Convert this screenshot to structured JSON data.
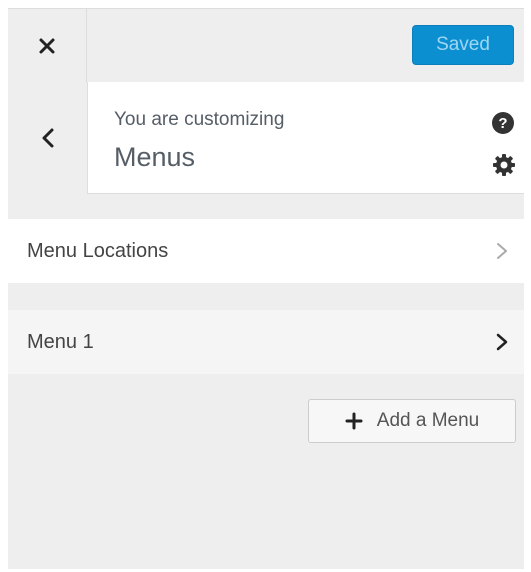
{
  "header": {
    "close_icon": "close-icon",
    "saved_label": "Saved",
    "saved_color": "#0b8fd1"
  },
  "info": {
    "customizing_label": "You are customizing",
    "section_title": "Menus",
    "help_icon": "help-icon",
    "help_glyph": "?",
    "settings_icon": "gear-icon",
    "back_icon": "chevron-left-icon"
  },
  "sections": {
    "locations": {
      "label": "Menu Locations",
      "icon": "chevron-right-icon"
    },
    "menu1": {
      "label": "Menu 1",
      "icon": "chevron-right-icon"
    }
  },
  "actions": {
    "add_menu_label": "Add a Menu",
    "add_icon": "plus-icon"
  }
}
